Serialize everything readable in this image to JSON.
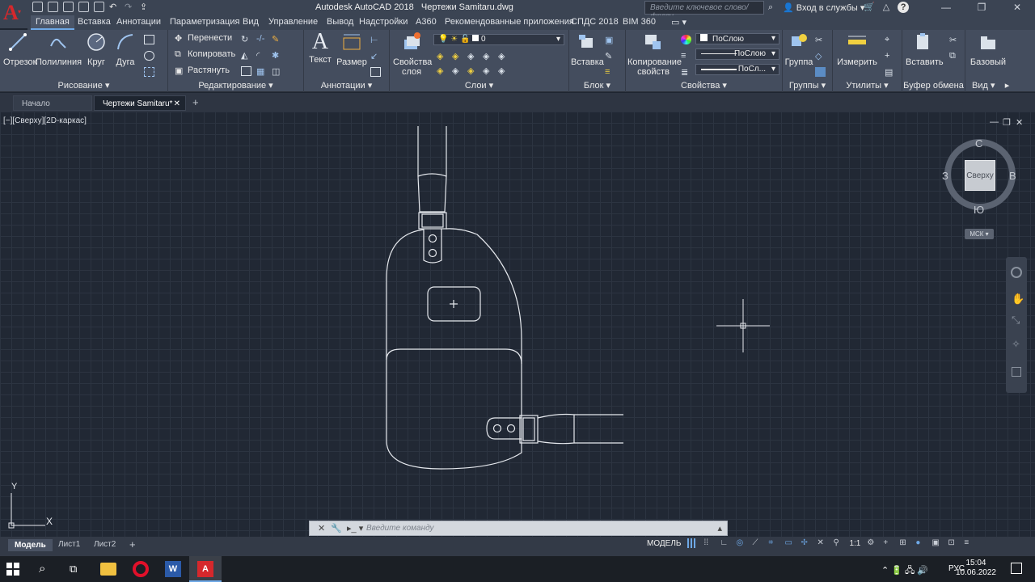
{
  "app": {
    "title": "Autodesk AutoCAD 2018",
    "document": "Чертежи Samitaru.dwg",
    "search_placeholder": "Введите ключевое слово/фразу",
    "login": "Вход в службы"
  },
  "ribbon_tabs": [
    "Главная",
    "Вставка",
    "Аннотации",
    "Параметризация",
    "Вид",
    "Управление",
    "Вывод",
    "Надстройки",
    "A360",
    "Рекомендованные приложения",
    "СПДС 2018",
    "BIM 360"
  ],
  "panels": {
    "draw": {
      "title": "Рисование",
      "buttons": [
        "Отрезок",
        "Полилиния",
        "Круг",
        "Дуга"
      ]
    },
    "modify": {
      "title": "Редактирование",
      "rows": [
        "Перенести",
        "Копировать",
        "Растянуть"
      ]
    },
    "annotation": {
      "title": "Аннотации",
      "buttons": [
        "Текст",
        "Размер"
      ]
    },
    "layers": {
      "title": "Слои",
      "button": "Свойства\nслоя",
      "layer_value": "0"
    },
    "block": {
      "title": "Блок",
      "button": "Вставка"
    },
    "properties": {
      "title": "Свойства",
      "button": "Копирование\nсвойств",
      "color": "ПоСлою",
      "linetype": "ПоСлою",
      "lineweight": "ПоСл..."
    },
    "groups": {
      "title": "Группы",
      "button": "Группа"
    },
    "utilities": {
      "title": "Утилиты",
      "button": "Измерить"
    },
    "clipboard": {
      "title": "Буфер обмена",
      "button": "Вставить"
    },
    "view": {
      "title": "Вид",
      "button": "Базовый"
    }
  },
  "doc_tabs": [
    "Начало",
    "Чертежи Samitaru*"
  ],
  "viewport_label": "[−][Сверху][2D-каркас]",
  "viewcube": {
    "top": "Сверху",
    "north": "С",
    "south": "Ю",
    "west": "З",
    "east": "В",
    "ucs": "МСК"
  },
  "ucs_icon": {
    "x": "X",
    "y": "Y"
  },
  "command": {
    "placeholder": "Введите команду"
  },
  "layout_tabs": [
    "Модель",
    "Лист1",
    "Лист2"
  ],
  "status": {
    "model": "МОДЕЛЬ",
    "scale": "1:1"
  },
  "taskbar": {
    "lang": "РУС",
    "time": "15:04",
    "date": "10.06.2022"
  },
  "colors": {
    "accent": "#6ea8e6",
    "drawing_bg": "#212834",
    "ribbon_bg": "#444d5e",
    "autocad_red": "#d6282c"
  }
}
